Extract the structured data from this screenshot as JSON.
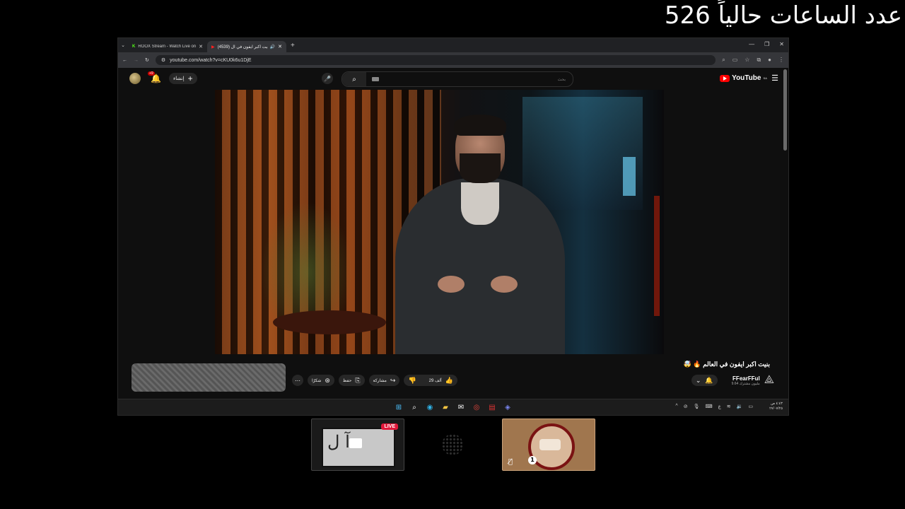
{
  "overlay": {
    "text": "عدد الساعات حالياً",
    "count": "526"
  },
  "browser": {
    "tabs": [
      {
        "favicon": "K",
        "title": "ROOX Stream - Watch Live on K"
      },
      {
        "favicon": "▶",
        "title": "(4539) بنيت اكبر ايفون في ال"
      }
    ],
    "url": "youtube.com/watch?v=cKU0k6u1DjE"
  },
  "youtube": {
    "notif_count": "+9",
    "create_label": "إنشاء",
    "search_placeholder": "بحث",
    "logo": "YouTube",
    "region": "SA"
  },
  "video": {
    "title": "بنيت اكبر ايفون في العالم 🔥 🤯",
    "channel_name": "FFearFFul",
    "subscribers": "9.64 مليون مشترك",
    "likes": "29 ألف",
    "share_label": "مشاركة",
    "save_label": "حفظ",
    "thanks_label": "شكرًا"
  },
  "taskbar": {
    "lang": "ع",
    "clock_time": "٤:٤٣ ص",
    "clock_date": "٢٧/٠٧/٢٥"
  },
  "cams": {
    "live_label": "LIVE",
    "board_text": "آ ل",
    "badge": "1"
  }
}
